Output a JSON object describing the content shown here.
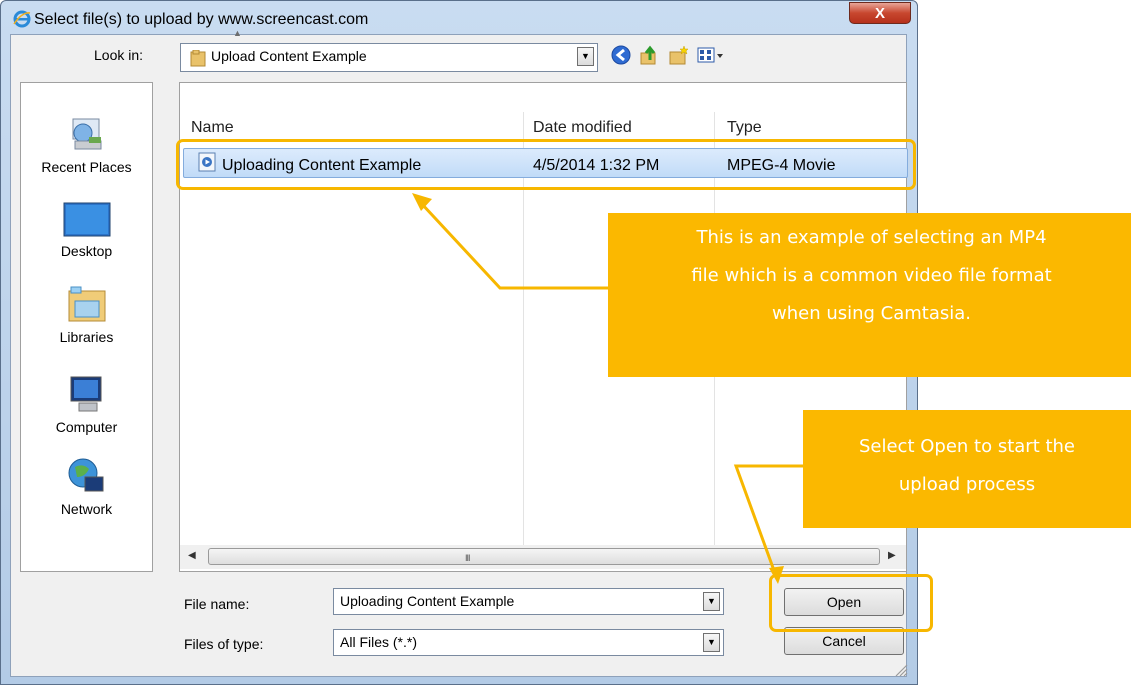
{
  "window": {
    "title": "Select file(s) to upload by www.screencast.com",
    "close_glyph": "X"
  },
  "toolbar": {
    "look_in_label": "Look in:",
    "look_in_value": "Upload Content Example",
    "icons": [
      "back-icon",
      "up-folder-icon",
      "new-folder-icon",
      "views-menu-icon"
    ]
  },
  "places": [
    {
      "label": "Recent Places",
      "icon": "recent-places-icon"
    },
    {
      "label": "Desktop",
      "icon": "desktop-icon"
    },
    {
      "label": "Libraries",
      "icon": "libraries-icon"
    },
    {
      "label": "Computer",
      "icon": "computer-icon"
    },
    {
      "label": "Network",
      "icon": "network-icon"
    }
  ],
  "file_list": {
    "columns": [
      "Name",
      "Date modified",
      "Type"
    ],
    "rows": [
      {
        "name": "Uploading Content Example",
        "date_modified": "4/5/2014 1:32 PM",
        "type": "MPEG-4 Movie",
        "selected": true
      }
    ]
  },
  "scrollbar": {
    "grip": "III"
  },
  "form": {
    "file_name_label": "File name:",
    "file_name_value": "Uploading Content Example",
    "files_of_type_label": "Files of type:",
    "files_of_type_value": "All Files (*.*)"
  },
  "buttons": {
    "open": "Open",
    "cancel": "Cancel"
  },
  "callouts": {
    "file": [
      "This is an example of selecting an MP4",
      "file which is a common video file format",
      "when using Camtasia."
    ],
    "open": [
      "Select Open to start the",
      "upload process"
    ]
  },
  "colors": {
    "highlight": "#f7b700",
    "callout_bg": "#fbb800",
    "selection": "#c9e0fa"
  }
}
